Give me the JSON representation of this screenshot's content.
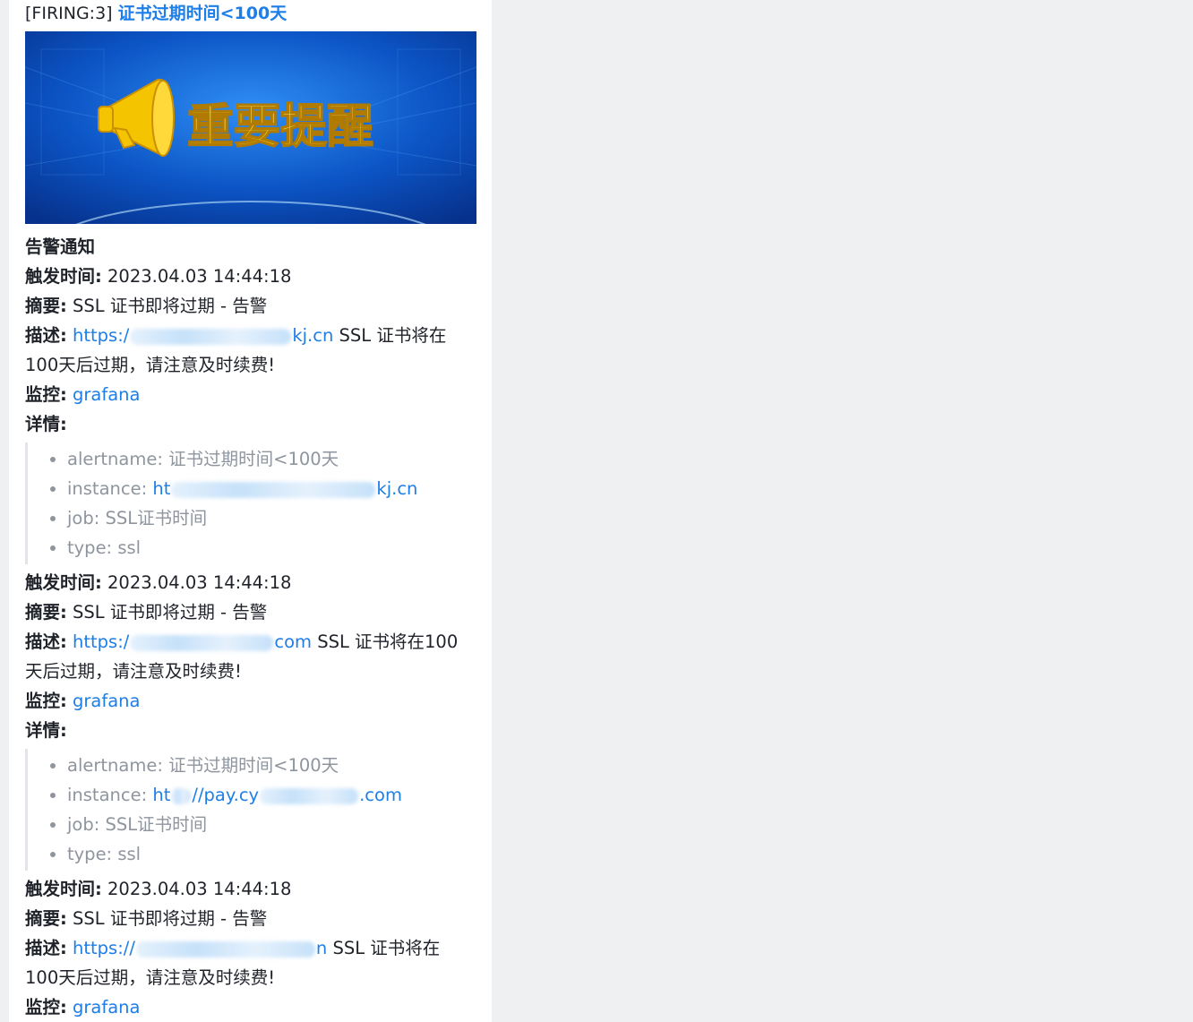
{
  "message": {
    "title_prefix": "[FIRING:3]",
    "title_link": "证书过期时间<100天",
    "banner_text": "重要提醒",
    "notice_heading": "告警通知"
  },
  "labels": {
    "time": "触发时间:",
    "summary": "摘要:",
    "desc": "描述:",
    "monitor": "监控:",
    "details": "详情:"
  },
  "alerts": [
    {
      "time": "2023.04.03 14:44:18",
      "summary": "SSL 证书即将过期 - 告警",
      "desc_link_start": "https:/",
      "desc_link_end": "kj.cn",
      "desc_text_1": "SSL 证书将在",
      "desc_text_2": "100天后过期，请注意及时续费!",
      "monitor": "grafana",
      "details": {
        "alertname_key": "alertname:",
        "alertname_val": "证书过期时间<100天",
        "instance_key": "instance:",
        "instance_start": "ht",
        "instance_end": "kj.cn",
        "job": "job: SSL证书时间",
        "type": "type: ssl"
      }
    },
    {
      "time": "2023.04.03 14:44:18",
      "summary": "SSL 证书即将过期 - 告警",
      "desc_link_start": "https:/",
      "desc_link_end": "com",
      "desc_text_1": "SSL 证书将在100",
      "desc_text_2": "天后过期，请注意及时续费!",
      "monitor": "grafana",
      "details": {
        "alertname_key": "alertname:",
        "alertname_val": "证书过期时间<100天",
        "instance_key": "instance:",
        "instance_start": "ht",
        "instance_mid": "//pay.cy",
        "instance_end": ".com",
        "job": "job: SSL证书时间",
        "type": "type: ssl"
      }
    },
    {
      "time": "2023.04.03 14:44:18",
      "summary": "SSL 证书即将过期 - 告警",
      "desc_link_start": "https://",
      "desc_link_end": "n",
      "desc_text_1": "SSL 证书将在",
      "desc_text_2": "100天后过期，请注意及时续费!",
      "monitor": "grafana"
    }
  ]
}
